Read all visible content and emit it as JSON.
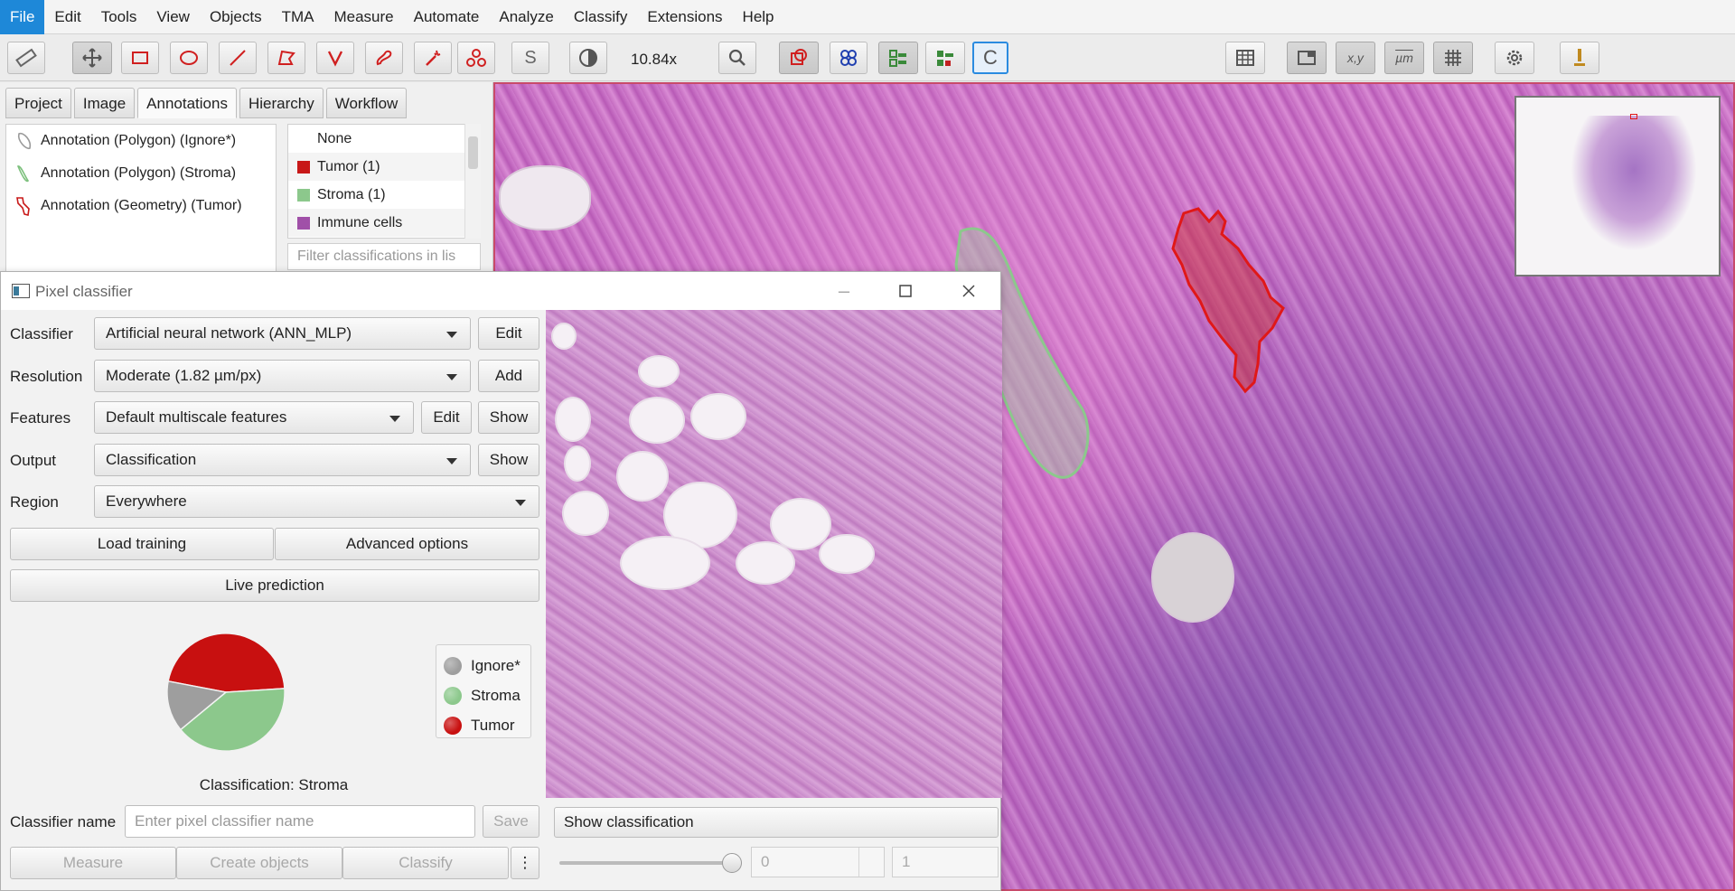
{
  "menu": [
    "File",
    "Edit",
    "Tools",
    "View",
    "Objects",
    "TMA",
    "Measure",
    "Automate",
    "Analyze",
    "Classify",
    "Extensions",
    "Help"
  ],
  "toolbar": {
    "zoom": "10.84x",
    "brush_letter": "S",
    "points_letter": "C",
    "coords_label": "x,y",
    "units_label": "µm"
  },
  "left_tabs": [
    "Project",
    "Image",
    "Annotations",
    "Hierarchy",
    "Workflow"
  ],
  "annotations": [
    {
      "label": "Annotation (Polygon) (Ignore*)",
      "color": "#9a9a9a"
    },
    {
      "label": "Annotation (Polygon) (Stroma)",
      "color": "#7cc07c"
    },
    {
      "label": "Annotation (Geometry) (Tumor)",
      "color": "#c81818"
    }
  ],
  "classes": [
    {
      "label": "None",
      "color": ""
    },
    {
      "label": "Tumor (1)",
      "color": "#c81818"
    },
    {
      "label": "Stroma (1)",
      "color": "#8cc88c"
    },
    {
      "label": "Immune cells",
      "color": "#a050a8"
    }
  ],
  "class_filter_placeholder": "Filter classifications in lis",
  "dialog": {
    "title": "Pixel classifier",
    "classifier_label": "Classifier",
    "classifier_value": "Artificial neural network (ANN_MLP)",
    "classifier_edit": "Edit",
    "resolution_label": "Resolution",
    "resolution_value": "Moderate (1.82 µm/px)",
    "resolution_add": "Add",
    "features_label": "Features",
    "features_value": "Default multiscale features",
    "features_edit": "Edit",
    "features_show": "Show",
    "output_label": "Output",
    "output_value": "Classification",
    "output_show": "Show",
    "region_label": "Region",
    "region_value": "Everywhere",
    "load_training": "Load training",
    "advanced_options": "Advanced options",
    "live_prediction": "Live prediction",
    "legend": [
      {
        "label": "Ignore*",
        "color": "#9e9e9e"
      },
      {
        "label": "Stroma",
        "color": "#8cc88c"
      },
      {
        "label": "Tumor",
        "color": "#c81010"
      }
    ],
    "classification_caption": "Classification: Stroma",
    "name_label": "Classifier name",
    "name_placeholder": "Enter pixel classifier name",
    "save": "Save",
    "measure": "Measure",
    "create_objects": "Create objects",
    "classify": "Classify",
    "more": "⋮",
    "show_classification": "Show classification",
    "spinner_min": "0",
    "spinner_max": "1"
  },
  "chart_data": {
    "type": "pie",
    "categories": [
      "Tumor",
      "Stroma",
      "Ignore*"
    ],
    "values": [
      46,
      40,
      14
    ],
    "colors": [
      "#c81010",
      "#8cc88c",
      "#9e9e9e"
    ]
  }
}
